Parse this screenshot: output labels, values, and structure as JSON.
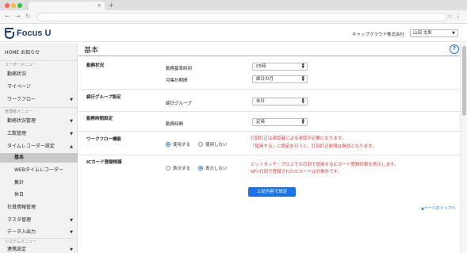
{
  "app": {
    "logo_text": "Focus U",
    "company": "キャップクラウド株式会社",
    "user": "山田 太郎"
  },
  "sidebar": {
    "home": "HOME お知らせ",
    "user_section": "ユーザーメニュー",
    "user_items": [
      "勤務状況",
      "マイページ",
      "ワークフロー"
    ],
    "admin_section": "管理者メニュー",
    "admin_items": [
      "勤務状況管理",
      "工数管理",
      "タイムレコーダー設定"
    ],
    "recorder_sub": [
      "基本",
      "WEBタイムレコーダー",
      "集計",
      "休日"
    ],
    "admin_items2": [
      "社員情報管理",
      "マスタ管理",
      "データ入出力"
    ],
    "system_section": "システムメニュー",
    "system_items": [
      "連携設定"
    ]
  },
  "main": {
    "title": "基本",
    "sections": {
      "work_status": {
        "label": "勤務状況",
        "fields": [
          {
            "label": "勤務基準時刻",
            "value": "05時"
          },
          {
            "label": "月集計期間",
            "value": "締日の月"
          }
        ]
      },
      "closing_group": {
        "label": "締日グループ設定",
        "field_label": "締日グループ",
        "value": "末日"
      },
      "work_time": {
        "label": "勤務時間設定",
        "field_label": "勤務時間",
        "value": "定時"
      },
      "workflow": {
        "label": "ワークフロー機能",
        "option_on": "使用する",
        "option_off": "使用しない",
        "selected": "使用する",
        "notes": [
          "打刻訂正は承認者による承認が必要になります。",
          "「使用する」に設定を行うと、打刻訂正制限は無効となります。"
        ]
      },
      "ic_card": {
        "label": "ICカード登録情報",
        "option_on": "表示する",
        "option_off": "表示しない",
        "selected": "表示しない",
        "notes": [
          "ピットタッチ・プロ２での打刻で使用するICカード登録件数を表示します。",
          "NFC打刻で登録されたICカードは対象外です。"
        ]
      }
    },
    "submit_label": "上記内容で設定",
    "page_top": "▲ページのトップへ"
  },
  "colors": {
    "accent": "#1a73e8",
    "warning": "#e23b3b",
    "sidebar_active": "#c9c9c9"
  }
}
